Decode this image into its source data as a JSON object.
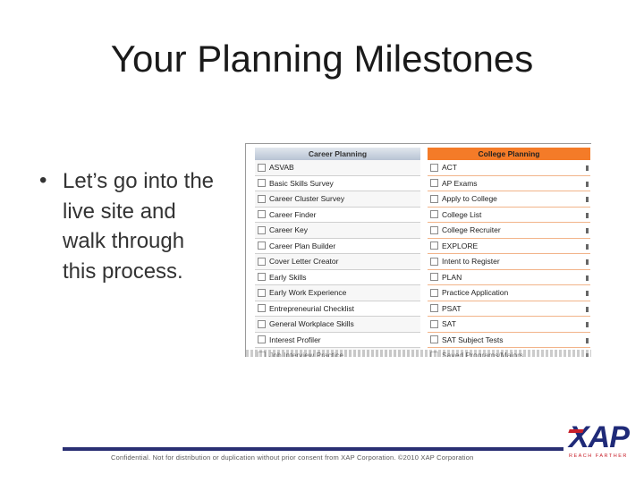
{
  "slide": {
    "title": "Your Planning Milestones",
    "bullet": "Let’s go into the live site and walk through this process."
  },
  "career_planning": {
    "header": "Career Planning",
    "items": [
      "ASVAB",
      "Basic Skills Survey",
      "Career Cluster Survey",
      "Career Finder",
      "Career Key",
      "Career Plan Builder",
      "Cover Letter Creator",
      "Early Skills",
      "Early Work Experience",
      "Entrepreneurial Checklist",
      "General Workplace Skills",
      "Interest Profiler",
      "Job Interview Practice"
    ]
  },
  "college_planning": {
    "header": "College Planning",
    "items": [
      "ACT",
      "AP Exams",
      "Apply to College",
      "College List",
      "College Recruiter",
      "EXPLORE",
      "Intent to Register",
      "PLAN",
      "Practice Application",
      "PSAT",
      "SAT",
      "SAT Subject Tests",
      "Saved Programs/Majors"
    ]
  },
  "footer": {
    "text": "Confidential. Not for distribution or duplication without prior consent from XAP Corporation. ©2010 XAP Corporation"
  },
  "logo": {
    "main": "XAP",
    "tagline": "REACH FARTHER"
  },
  "colors": {
    "accent_orange": "#f47b28",
    "brand_navy": "#1f2a78",
    "brand_red": "#c8202b"
  }
}
